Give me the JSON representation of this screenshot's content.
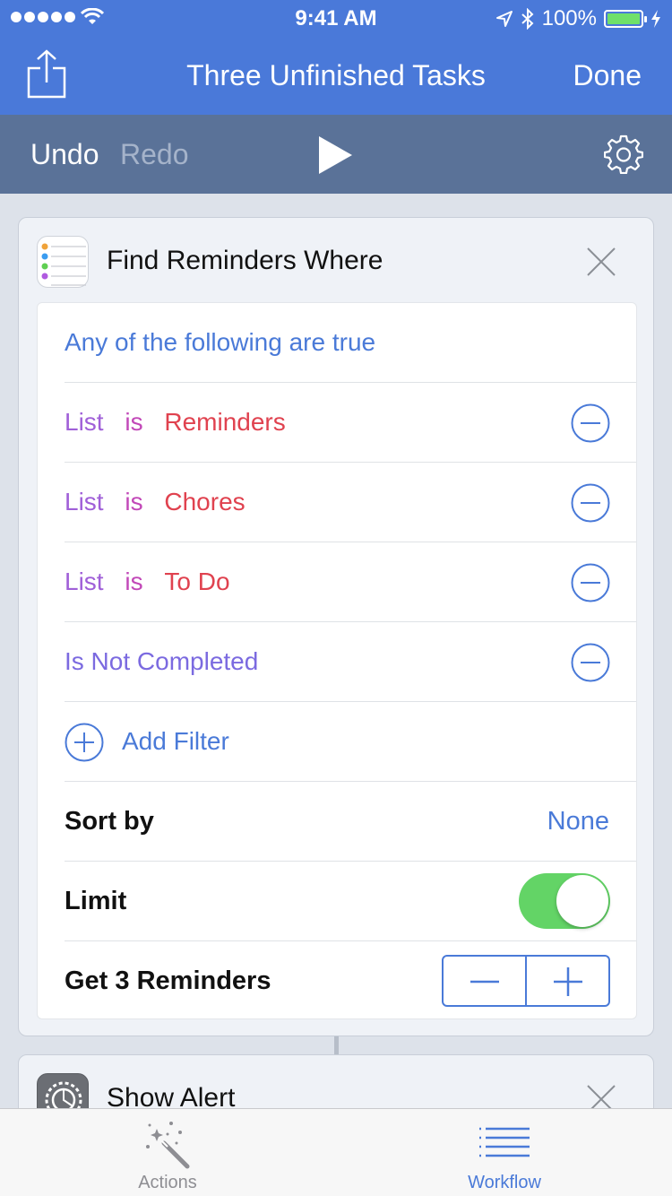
{
  "status_bar": {
    "time": "9:41 AM",
    "battery": "100%",
    "icons": [
      "signal-dots-icon",
      "wifi-icon",
      "location-arrow-icon",
      "bluetooth-icon",
      "battery-icon",
      "charging-bolt-icon"
    ]
  },
  "nav": {
    "title": "Three Unfinished Tasks",
    "done_label": "Done",
    "share_icon": "share-icon"
  },
  "toolbar": {
    "undo_label": "Undo",
    "redo_label": "Redo",
    "play_icon": "play-icon",
    "settings_icon": "gear-icon"
  },
  "find_card": {
    "title": "Find Reminders Where",
    "icon": "reminders-app-icon",
    "match_mode": "Any of the following are true",
    "filters": [
      {
        "field": "List",
        "op": "is",
        "value": "Reminders"
      },
      {
        "field": "List",
        "op": "is",
        "value": "Chores"
      },
      {
        "field": "List",
        "op": "is",
        "value": "To Do"
      },
      {
        "field": "Is Not Completed",
        "op": "",
        "value": ""
      }
    ],
    "add_filter_label": "Add Filter",
    "sort_label": "Sort by",
    "sort_value": "None",
    "limit_label": "Limit",
    "limit_enabled": true,
    "get_label": "Get 3 Reminders",
    "get_count": 3
  },
  "alert_card": {
    "title": "Show Alert",
    "icon": "settings-app-icon"
  },
  "tabs": [
    {
      "label": "Actions",
      "icon": "magic-wand-icon",
      "active": false
    },
    {
      "label": "Workflow",
      "icon": "list-lines-icon",
      "active": true
    }
  ],
  "colors": {
    "accent": "#4a79d9",
    "toolbar": "#5a7298",
    "field": "#a060d8",
    "operator": "#c248b8",
    "value": "#e0424f",
    "toggle_on": "#63d466"
  }
}
